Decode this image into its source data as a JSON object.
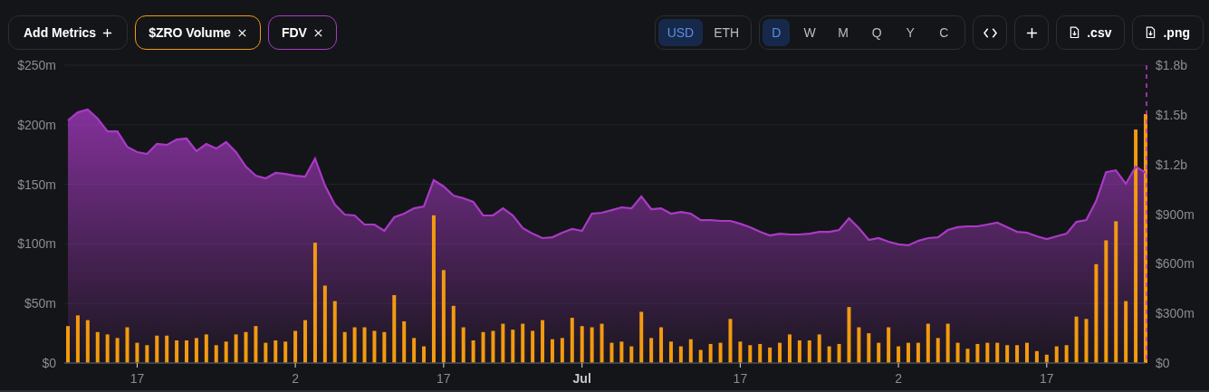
{
  "metrics": [
    {
      "kind": "add",
      "label": "Add Metrics"
    }
  ],
  "currency": [
    {
      "label": "USD",
      "selected": true
    },
    {
      "label": "ETH",
      "selected": false
    }
  ],
  "periods": [
    {
      "label": "D",
      "selected": true
    },
    {
      "label": "W",
      "selected": false
    },
    {
      "label": "M",
      "selected": false
    },
    {
      "label": "Q",
      "selected": false
    },
    {
      "label": "Y",
      "selected": false
    },
    {
      "label": "C",
      "selected": false
    }
  ],
  "actions": [
    {
      "kind": "embed"
    },
    {
      "kind": "add"
    },
    {
      "kind": "download",
      "label": ".csv"
    },
    {
      "kind": "download",
      "label": ".png"
    }
  ],
  "chart_data": {
    "type": "bar",
    "grid": true,
    "ylim": [
      0,
      250000000
    ],
    "y2lim": [
      0,
      1800000000
    ],
    "yticks": [
      {
        "value": 0,
        "label": "$0"
      },
      {
        "value": 50000000,
        "label": "$50m"
      },
      {
        "value": 100000000,
        "label": "$100m"
      },
      {
        "value": 150000000,
        "label": "$150m"
      },
      {
        "value": 200000000,
        "label": "$200m"
      },
      {
        "value": 250000000,
        "label": "$250m"
      }
    ],
    "y2ticks": [
      {
        "value": 0,
        "label": "$0"
      },
      {
        "value": 300000000,
        "label": "$300m"
      },
      {
        "value": 600000000,
        "label": "$600m"
      },
      {
        "value": 900000000,
        "label": "$900m"
      },
      {
        "value": 1200000000,
        "label": "$1.2b"
      },
      {
        "value": 1500000000,
        "label": "$1.5b"
      },
      {
        "value": 1800000000,
        "label": "$1.8b"
      }
    ],
    "categories": [
      null,
      null,
      null,
      null,
      null,
      null,
      null,
      "17",
      null,
      null,
      null,
      null,
      null,
      null,
      null,
      null,
      null,
      null,
      null,
      null,
      null,
      null,
      null,
      "2",
      null,
      null,
      null,
      null,
      null,
      null,
      null,
      null,
      null,
      null,
      null,
      null,
      null,
      null,
      "17",
      null,
      null,
      null,
      null,
      null,
      null,
      null,
      null,
      null,
      null,
      null,
      null,
      null,
      "Jul",
      null,
      null,
      null,
      null,
      null,
      null,
      null,
      null,
      null,
      null,
      null,
      null,
      null,
      null,
      null,
      "17",
      null,
      null,
      null,
      null,
      null,
      null,
      null,
      null,
      null,
      null,
      null,
      null,
      null,
      null,
      null,
      "2",
      null,
      null,
      null,
      null,
      null,
      null,
      null,
      null,
      null,
      null,
      null,
      null,
      null,
      null,
      "17",
      null,
      null,
      null,
      null,
      null,
      null,
      null,
      null,
      null,
      null
    ],
    "series": [
      {
        "name": "$ZRO Volume",
        "type": "bar",
        "color": "#f29a0f",
        "values": [
          31000000,
          40000000,
          36000000,
          26000000,
          24000000,
          21000000,
          30000000,
          17000000,
          15000000,
          23000000,
          23000000,
          19000000,
          19000000,
          21000000,
          24000000,
          15000000,
          18000000,
          24000000,
          26000000,
          31000000,
          17000000,
          19000000,
          18000000,
          27000000,
          36000000,
          101000000,
          65000000,
          52000000,
          26000000,
          30000000,
          30000000,
          27000000,
          26000000,
          57000000,
          35000000,
          21000000,
          14000000,
          124000000,
          78000000,
          48000000,
          30000000,
          19000000,
          26000000,
          27000000,
          33000000,
          28000000,
          33000000,
          27000000,
          36000000,
          20000000,
          21000000,
          38000000,
          31000000,
          30000000,
          33000000,
          17000000,
          18000000,
          14000000,
          43000000,
          21000000,
          30000000,
          18000000,
          14000000,
          20000000,
          11000000,
          16000000,
          17000000,
          37000000,
          18000000,
          15000000,
          16000000,
          13000000,
          17000000,
          24000000,
          19000000,
          19000000,
          24000000,
          14000000,
          16000000,
          47000000,
          30000000,
          25000000,
          17000000,
          30000000,
          14000000,
          17000000,
          17000000,
          33000000,
          21000000,
          33000000,
          17000000,
          12000000,
          16000000,
          17000000,
          17000000,
          15000000,
          15000000,
          17000000,
          10000000,
          7000000,
          14000000,
          15000000,
          39000000,
          37000000,
          83000000,
          103000000,
          119000000,
          52000000,
          196000000,
          209000000
        ]
      },
      {
        "name": "FDV",
        "type": "area",
        "axis": "y2",
        "color": "#a93ac6",
        "values": [
          1466000000,
          1515000000,
          1532000000,
          1477000000,
          1400000000,
          1400000000,
          1307000000,
          1275000000,
          1264000000,
          1324000000,
          1318000000,
          1351000000,
          1357000000,
          1280000000,
          1324000000,
          1296000000,
          1335000000,
          1275000000,
          1187000000,
          1132000000,
          1116000000,
          1149000000,
          1143000000,
          1132000000,
          1127000000,
          1236000000,
          1072000000,
          957000000,
          897000000,
          892000000,
          837000000,
          837000000,
          799000000,
          881000000,
          903000000,
          935000000,
          946000000,
          1105000000,
          1067000000,
          1012000000,
          996000000,
          974000000,
          892000000,
          892000000,
          935000000,
          892000000,
          815000000,
          782000000,
          755000000,
          760000000,
          788000000,
          810000000,
          799000000,
          903000000,
          908000000,
          924000000,
          941000000,
          935000000,
          1006000000,
          930000000,
          935000000,
          903000000,
          913000000,
          903000000,
          864000000,
          864000000,
          859000000,
          859000000,
          842000000,
          821000000,
          793000000,
          771000000,
          782000000,
          777000000,
          777000000,
          782000000,
          793000000,
          793000000,
          804000000,
          875000000,
          815000000,
          744000000,
          755000000,
          733000000,
          717000000,
          711000000,
          738000000,
          755000000,
          760000000,
          804000000,
          821000000,
          826000000,
          826000000,
          837000000,
          848000000,
          821000000,
          793000000,
          788000000,
          766000000,
          749000000,
          766000000,
          782000000,
          853000000,
          864000000,
          979000000,
          1154000000,
          1165000000,
          1083000000,
          1187000000,
          1150000000
        ]
      }
    ]
  }
}
